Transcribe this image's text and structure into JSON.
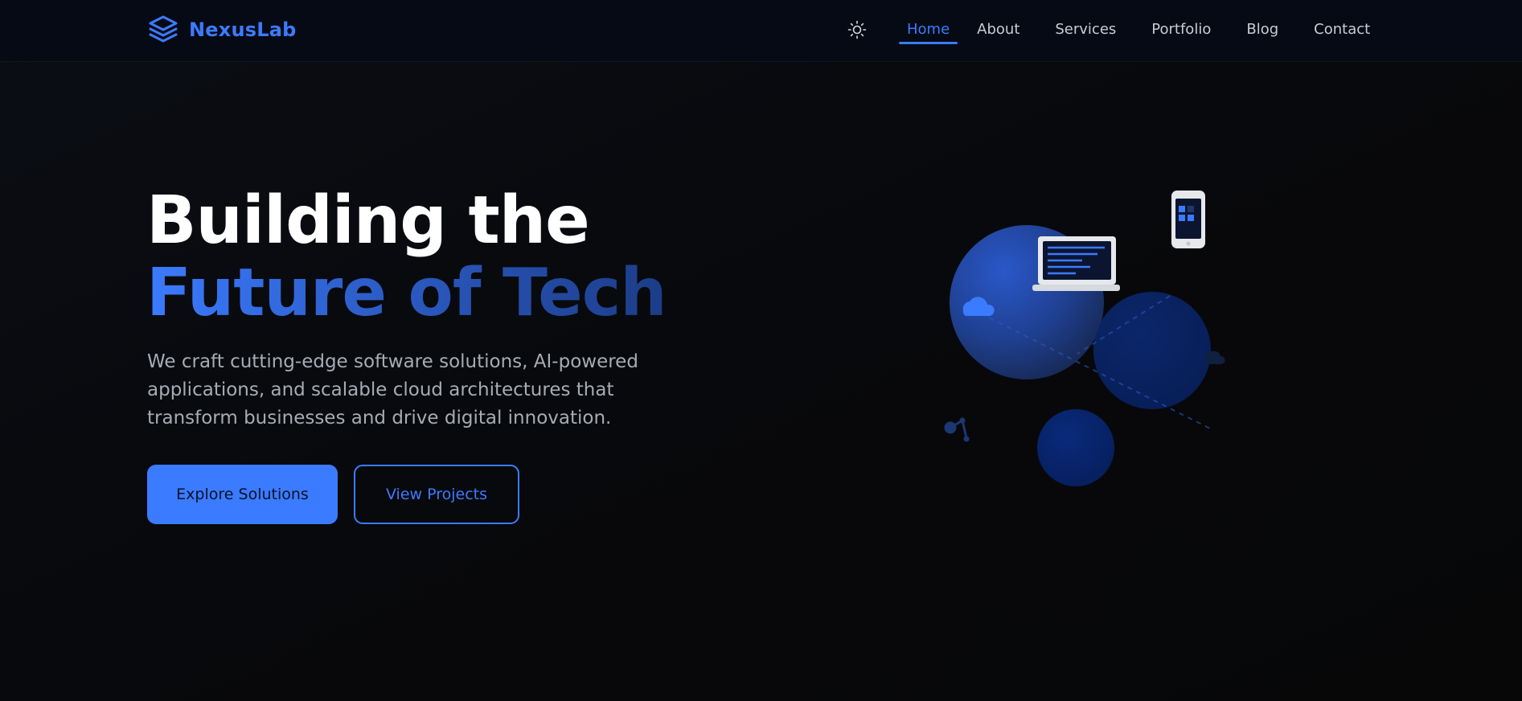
{
  "brand": {
    "name": "NexusLab",
    "icon": "layers-icon",
    "color": "#3b7bff"
  },
  "theme_toggle": {
    "icon": "sun-icon"
  },
  "nav": {
    "active": "Home",
    "items": [
      {
        "label": "Home"
      },
      {
        "label": "About"
      },
      {
        "label": "Services"
      },
      {
        "label": "Portfolio"
      },
      {
        "label": "Blog"
      },
      {
        "label": "Contact"
      }
    ]
  },
  "hero": {
    "title_line1": "Building the",
    "title_line2": "Future of Tech",
    "description": "We craft cutting-edge software solutions, AI-powered applications, and scalable cloud architectures that transform businesses and drive digital innovation.",
    "primary_button": "Explore Solutions",
    "secondary_button": "View Projects"
  },
  "illustration": {
    "icons": [
      "laptop-icon",
      "smartphone-icon",
      "cloud-icon",
      "robot-arm-icon"
    ]
  },
  "colors": {
    "accent": "#3b7bff",
    "background": "#08090c",
    "navbar": "#060a14",
    "text_muted": "#a7abb3"
  }
}
